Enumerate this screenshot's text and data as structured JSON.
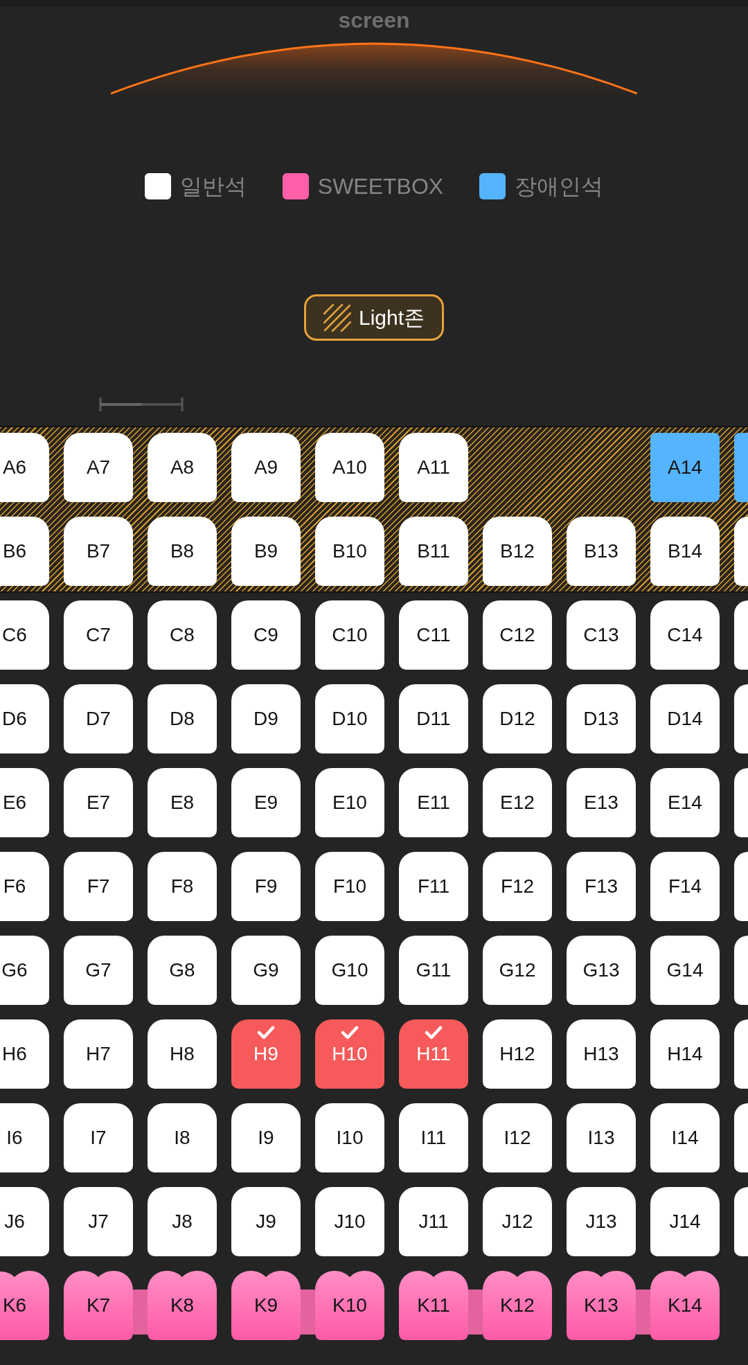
{
  "screen": {
    "label": "screen"
  },
  "legend": [
    {
      "label": "일반석",
      "color": "#ffffff"
    },
    {
      "label": "SWEETBOX",
      "color": "#ff5fa8"
    },
    {
      "label": "장애인석",
      "color": "#55b4ff"
    }
  ],
  "light_zone_badge": {
    "label": "Light존"
  },
  "zones": [
    {
      "kind": "light",
      "rows": [
        {
          "seats": [
            {
              "label": "A6",
              "kind": "standard",
              "selected": false
            },
            {
              "label": "A7",
              "kind": "standard",
              "selected": false
            },
            {
              "label": "A8",
              "kind": "standard",
              "selected": false
            },
            {
              "label": "A9",
              "kind": "standard",
              "selected": false
            },
            {
              "label": "A10",
              "kind": "standard",
              "selected": false
            },
            {
              "label": "A11",
              "kind": "standard",
              "selected": false
            },
            {
              "kind": "empty"
            },
            {
              "kind": "empty"
            },
            {
              "label": "A14",
              "kind": "accessible",
              "selected": false
            },
            {
              "kind": "accessible",
              "selected": false
            }
          ]
        },
        {
          "seats": [
            {
              "label": "B6",
              "kind": "standard",
              "selected": false
            },
            {
              "label": "B7",
              "kind": "standard",
              "selected": false
            },
            {
              "label": "B8",
              "kind": "standard",
              "selected": false
            },
            {
              "label": "B9",
              "kind": "standard",
              "selected": false
            },
            {
              "label": "B10",
              "kind": "standard",
              "selected": false
            },
            {
              "label": "B11",
              "kind": "standard",
              "selected": false
            },
            {
              "label": "B12",
              "kind": "standard",
              "selected": false
            },
            {
              "label": "B13",
              "kind": "standard",
              "selected": false
            },
            {
              "label": "B14",
              "kind": "standard",
              "selected": false
            },
            {
              "kind": "standard",
              "selected": false
            }
          ]
        }
      ]
    },
    {
      "kind": "regular",
      "rows": [
        {
          "seats": [
            {
              "label": "C6",
              "kind": "standard",
              "selected": false
            },
            {
              "label": "C7",
              "kind": "standard",
              "selected": false
            },
            {
              "label": "C8",
              "kind": "standard",
              "selected": false
            },
            {
              "label": "C9",
              "kind": "standard",
              "selected": false
            },
            {
              "label": "C10",
              "kind": "standard",
              "selected": false
            },
            {
              "label": "C11",
              "kind": "standard",
              "selected": false
            },
            {
              "label": "C12",
              "kind": "standard",
              "selected": false
            },
            {
              "label": "C13",
              "kind": "standard",
              "selected": false
            },
            {
              "label": "C14",
              "kind": "standard",
              "selected": false
            },
            {
              "kind": "standard",
              "selected": false
            }
          ]
        },
        {
          "seats": [
            {
              "label": "D6",
              "kind": "standard",
              "selected": false
            },
            {
              "label": "D7",
              "kind": "standard",
              "selected": false
            },
            {
              "label": "D8",
              "kind": "standard",
              "selected": false
            },
            {
              "label": "D9",
              "kind": "standard",
              "selected": false
            },
            {
              "label": "D10",
              "kind": "standard",
              "selected": false
            },
            {
              "label": "D11",
              "kind": "standard",
              "selected": false
            },
            {
              "label": "D12",
              "kind": "standard",
              "selected": false
            },
            {
              "label": "D13",
              "kind": "standard",
              "selected": false
            },
            {
              "label": "D14",
              "kind": "standard",
              "selected": false
            },
            {
              "kind": "standard",
              "selected": false
            }
          ]
        },
        {
          "seats": [
            {
              "label": "E6",
              "kind": "standard",
              "selected": false
            },
            {
              "label": "E7",
              "kind": "standard",
              "selected": false
            },
            {
              "label": "E8",
              "kind": "standard",
              "selected": false
            },
            {
              "label": "E9",
              "kind": "standard",
              "selected": false
            },
            {
              "label": "E10",
              "kind": "standard",
              "selected": false
            },
            {
              "label": "E11",
              "kind": "standard",
              "selected": false
            },
            {
              "label": "E12",
              "kind": "standard",
              "selected": false
            },
            {
              "label": "E13",
              "kind": "standard",
              "selected": false
            },
            {
              "label": "E14",
              "kind": "standard",
              "selected": false
            },
            {
              "kind": "standard",
              "selected": false
            }
          ]
        },
        {
          "seats": [
            {
              "label": "F6",
              "kind": "standard",
              "selected": false
            },
            {
              "label": "F7",
              "kind": "standard",
              "selected": false
            },
            {
              "label": "F8",
              "kind": "standard",
              "selected": false
            },
            {
              "label": "F9",
              "kind": "standard",
              "selected": false
            },
            {
              "label": "F10",
              "kind": "standard",
              "selected": false
            },
            {
              "label": "F11",
              "kind": "standard",
              "selected": false
            },
            {
              "label": "F12",
              "kind": "standard",
              "selected": false
            },
            {
              "label": "F13",
              "kind": "standard",
              "selected": false
            },
            {
              "label": "F14",
              "kind": "standard",
              "selected": false
            },
            {
              "kind": "standard",
              "selected": false
            }
          ]
        },
        {
          "seats": [
            {
              "label": "G6",
              "kind": "standard",
              "selected": false
            },
            {
              "label": "G7",
              "kind": "standard",
              "selected": false
            },
            {
              "label": "G8",
              "kind": "standard",
              "selected": false
            },
            {
              "label": "G9",
              "kind": "standard",
              "selected": false
            },
            {
              "label": "G10",
              "kind": "standard",
              "selected": false
            },
            {
              "label": "G11",
              "kind": "standard",
              "selected": false
            },
            {
              "label": "G12",
              "kind": "standard",
              "selected": false
            },
            {
              "label": "G13",
              "kind": "standard",
              "selected": false
            },
            {
              "label": "G14",
              "kind": "standard",
              "selected": false
            },
            {
              "kind": "standard",
              "selected": false
            }
          ]
        },
        {
          "seats": [
            {
              "label": "H6",
              "kind": "standard",
              "selected": false
            },
            {
              "label": "H7",
              "kind": "standard",
              "selected": false
            },
            {
              "label": "H8",
              "kind": "standard",
              "selected": false
            },
            {
              "label": "H9",
              "kind": "standard",
              "selected": true
            },
            {
              "label": "H10",
              "kind": "standard",
              "selected": true
            },
            {
              "label": "H11",
              "kind": "standard",
              "selected": true
            },
            {
              "label": "H12",
              "kind": "standard",
              "selected": false
            },
            {
              "label": "H13",
              "kind": "standard",
              "selected": false
            },
            {
              "label": "H14",
              "kind": "standard",
              "selected": false
            },
            {
              "kind": "standard",
              "selected": false
            }
          ]
        },
        {
          "seats": [
            {
              "label": "I6",
              "kind": "standard",
              "selected": false
            },
            {
              "label": "I7",
              "kind": "standard",
              "selected": false
            },
            {
              "label": "I8",
              "kind": "standard",
              "selected": false
            },
            {
              "label": "I9",
              "kind": "standard",
              "selected": false
            },
            {
              "label": "I10",
              "kind": "standard",
              "selected": false
            },
            {
              "label": "I11",
              "kind": "standard",
              "selected": false
            },
            {
              "label": "I12",
              "kind": "standard",
              "selected": false
            },
            {
              "label": "I13",
              "kind": "standard",
              "selected": false
            },
            {
              "label": "I14",
              "kind": "standard",
              "selected": false
            },
            {
              "kind": "standard",
              "selected": false
            }
          ]
        },
        {
          "seats": [
            {
              "label": "J6",
              "kind": "standard",
              "selected": false
            },
            {
              "label": "J7",
              "kind": "standard",
              "selected": false
            },
            {
              "label": "J8",
              "kind": "standard",
              "selected": false
            },
            {
              "label": "J9",
              "kind": "standard",
              "selected": false
            },
            {
              "label": "J10",
              "kind": "standard",
              "selected": false
            },
            {
              "label": "J11",
              "kind": "standard",
              "selected": false
            },
            {
              "label": "J12",
              "kind": "standard",
              "selected": false
            },
            {
              "label": "J13",
              "kind": "standard",
              "selected": false
            },
            {
              "label": "J14",
              "kind": "standard",
              "selected": false
            },
            {
              "kind": "standard",
              "selected": false
            }
          ]
        },
        {
          "seats": [
            {
              "label": "K6",
              "kind": "sweetbox-right",
              "selected": false
            },
            {
              "label": "K7",
              "kind": "sweetbox-left",
              "selected": false
            },
            {
              "label": "K8",
              "kind": "sweetbox-right",
              "selected": false
            },
            {
              "label": "K9",
              "kind": "sweetbox-left",
              "selected": false
            },
            {
              "label": "K10",
              "kind": "sweetbox-right",
              "selected": false
            },
            {
              "label": "K11",
              "kind": "sweetbox-left",
              "selected": false
            },
            {
              "label": "K12",
              "kind": "sweetbox-right",
              "selected": false
            },
            {
              "label": "K13",
              "kind": "sweetbox-left",
              "selected": false
            },
            {
              "label": "K14",
              "kind": "sweetbox-right",
              "selected": false
            }
          ]
        }
      ]
    }
  ]
}
